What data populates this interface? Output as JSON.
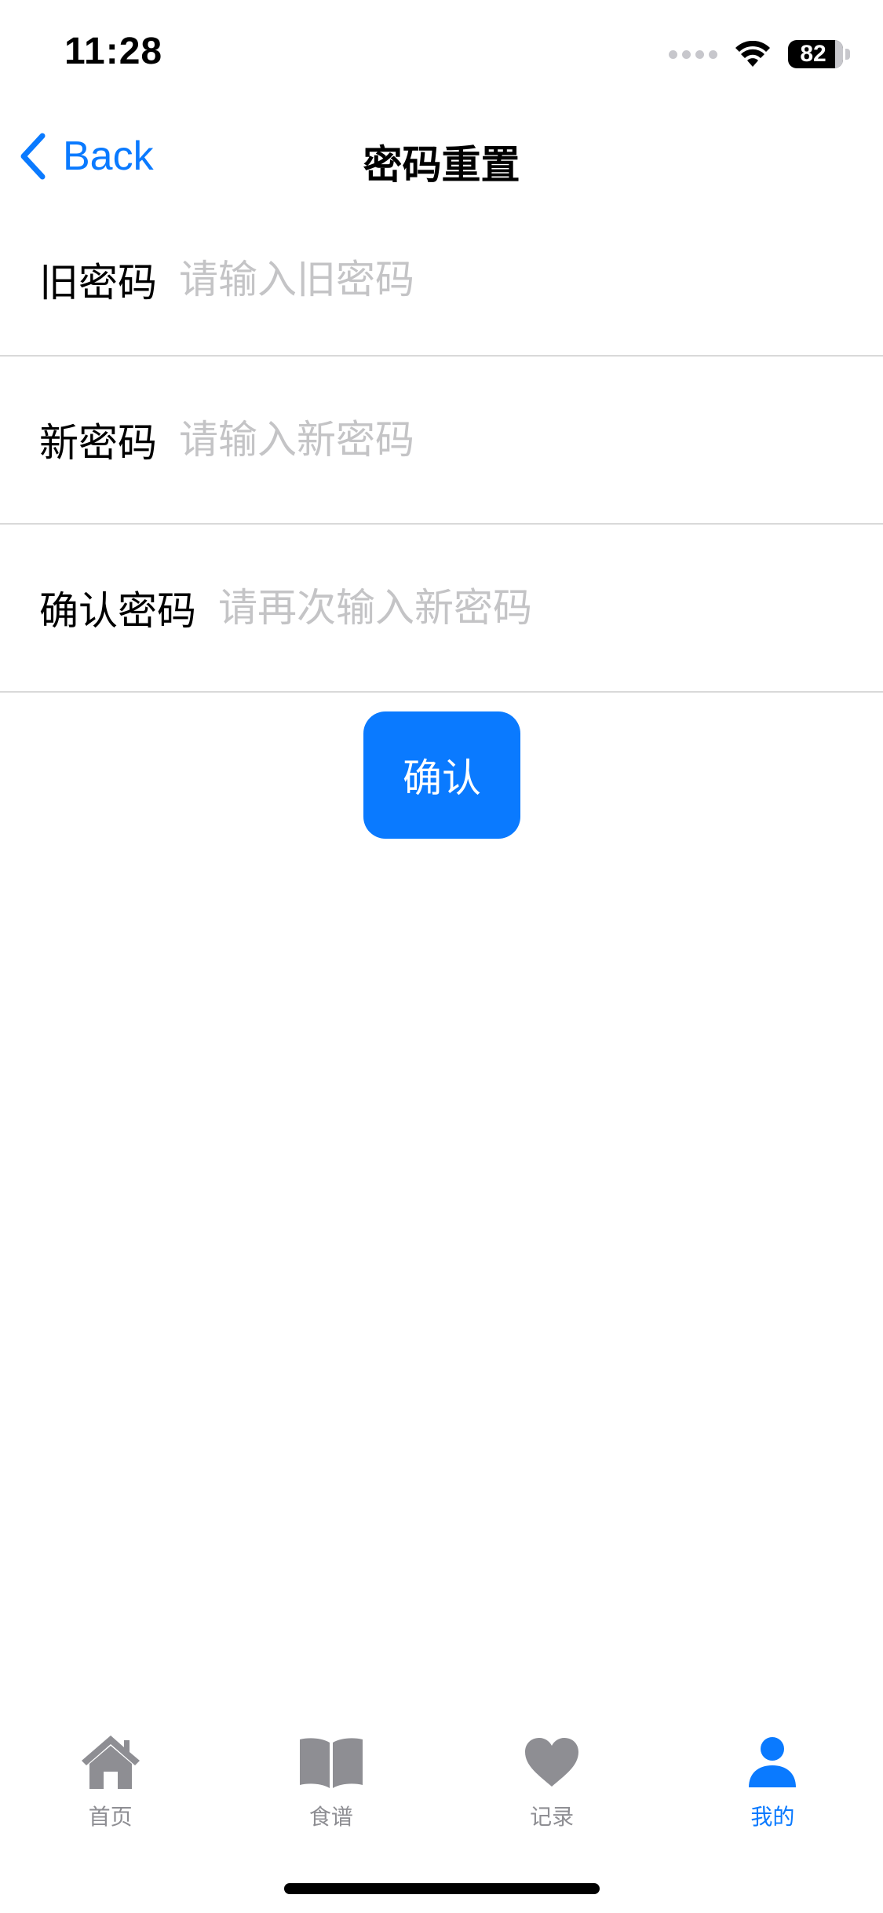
{
  "status_bar": {
    "time": "11:28",
    "battery": "82"
  },
  "nav": {
    "back_label": "Back",
    "title": "密码重置"
  },
  "form": {
    "old_password": {
      "label": "旧密码",
      "placeholder": "请输入旧密码",
      "value": ""
    },
    "new_password": {
      "label": "新密码",
      "placeholder": "请输入新密码",
      "value": ""
    },
    "confirm_password": {
      "label": "确认密码",
      "placeholder": "请再次输入新密码",
      "value": ""
    },
    "submit_label": "确认"
  },
  "tab_bar": {
    "items": [
      {
        "label": "首页",
        "icon": "house-icon",
        "active": false
      },
      {
        "label": "食谱",
        "icon": "book-icon",
        "active": false
      },
      {
        "label": "记录",
        "icon": "heart-icon",
        "active": false
      },
      {
        "label": "我的",
        "icon": "person-icon",
        "active": true
      }
    ]
  },
  "colors": {
    "accent": "#0a7aff",
    "inactive_tab": "#8e8e93",
    "placeholder": "#c4c4c6",
    "divider": "#d9d9d9"
  }
}
